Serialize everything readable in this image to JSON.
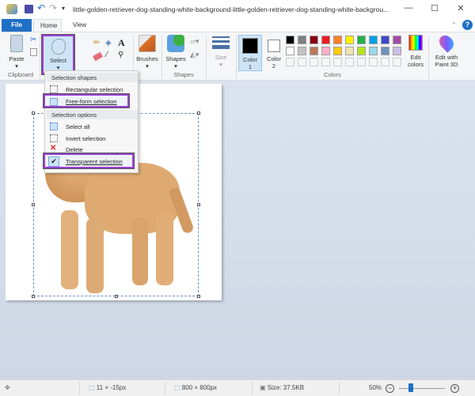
{
  "window": {
    "title": "little-golden-retriever-dog-standing-white-background-little-golden-retriever-dog-standing-white-backgrou...",
    "minimize": "—",
    "maximize": "☐",
    "close": "✕"
  },
  "tabs": {
    "file": "File",
    "home": "Home",
    "view": "View"
  },
  "ribbon": {
    "paste": "Paste",
    "clipboard": "Clipboard",
    "select": "Select",
    "brushes": "Brushes",
    "shapes": "Shapes",
    "shapes_group": "Shapes",
    "size": "Size",
    "color1": "Color\n1",
    "color1_a": "Color",
    "color1_b": "1",
    "color2_a": "Color",
    "color2_b": "2",
    "colors_group": "Colors",
    "edit_colors_a": "Edit",
    "edit_colors_b": "colors",
    "paint3d_a": "Edit with",
    "paint3d_b": "Paint 3D",
    "palette": [
      "#000000",
      "#7f7f7f",
      "#880015",
      "#ed1c24",
      "#ff7f27",
      "#fff200",
      "#22b14c",
      "#00a2e8",
      "#3f48cc",
      "#a349a4",
      "#ffffff",
      "#c3c3c3",
      "#b97a57",
      "#ffaec9",
      "#ffc90e",
      "#efe4b0",
      "#b5e61d",
      "#99d9ea",
      "#7092be",
      "#c8bfe7"
    ],
    "color1_value": "#000000",
    "color2_value": "#ffffff"
  },
  "menu": {
    "shapes_header": "Selection shapes",
    "rectangular": "Rectangular selection",
    "freeform": "Free-form selection",
    "options_header": "Selection options",
    "select_all": "Select all",
    "invert": "Invert selection",
    "delete": "Delete",
    "transparent": "Transparent selection"
  },
  "status": {
    "cursor": "11 × -15px",
    "dimensions": "800 × 800px",
    "size": "Size: 37.5KB",
    "zoom": "50%",
    "zoom_percent": 50
  },
  "accent": "#9b3fd6"
}
